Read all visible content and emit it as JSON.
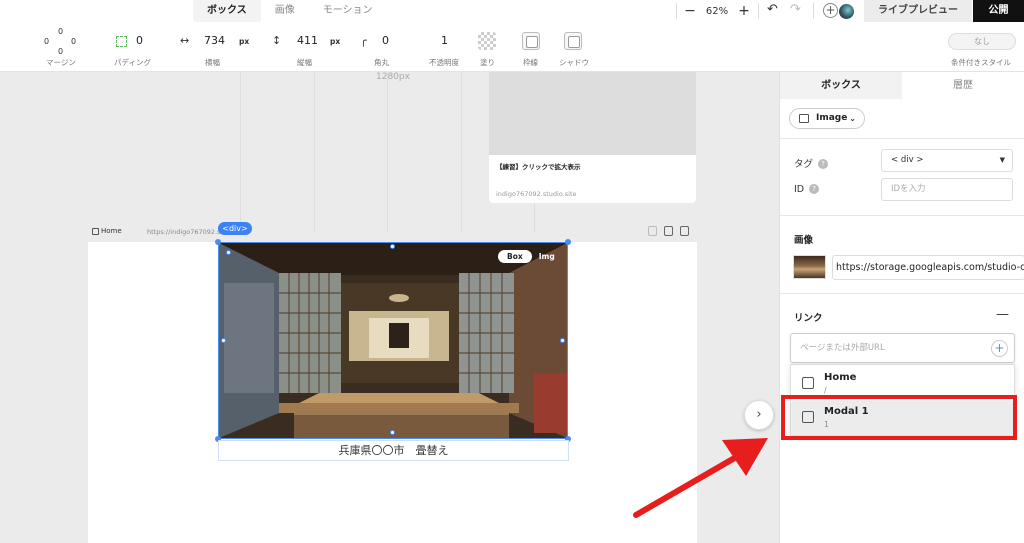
{
  "top_tabs": [
    "ボックス",
    "画像",
    "モーション"
  ],
  "zoom": {
    "minus": "−",
    "value": "62%",
    "plus": "+"
  },
  "header_buttons": {
    "live_preview": "ライブプレビュー",
    "publish": "公開"
  },
  "properties": {
    "margin": {
      "top": "0",
      "left": "0",
      "right": "0",
      "bottom": "0",
      "label": "マージン"
    },
    "padding": {
      "value": "0",
      "label": "パディング"
    },
    "width": {
      "value": "734",
      "unit": "px",
      "label": "横幅"
    },
    "height": {
      "value": "411",
      "unit": "px",
      "label": "縦幅"
    },
    "radius": {
      "value": "0",
      "label": "角丸"
    },
    "opacity": {
      "value": "1",
      "label": "不透明度"
    },
    "fill": {
      "label": "塗り"
    },
    "border": {
      "label": "枠線"
    },
    "shadow": {
      "label": "シャドウ"
    },
    "conditional": {
      "button": "なし",
      "label": "条件付きスタイル"
    }
  },
  "canvas": {
    "width_label": "1280px",
    "card_title": "【練習】クリックで拡大表示",
    "card_url": "indigo767092.studio.site",
    "frame_name": "Home",
    "frame_url": "https://indigo767092.stu",
    "element_badge": "<div>",
    "toggle_box": "Box",
    "toggle_img": "Img",
    "caption": "兵庫県〇〇市　畳替え"
  },
  "panel": {
    "tabs": [
      "ボックス",
      "層歴"
    ],
    "element_type": "Image",
    "tag_label": "タグ",
    "tag_value": "< div >",
    "id_label": "ID",
    "id_placeholder": "IDを入力",
    "image_section": "画像",
    "image_url": "https://storage.googleapis.com/studio-c",
    "link_section": "リンク",
    "link_placeholder": "ページまたは外部URL",
    "link_options": [
      {
        "name": "Home",
        "path": "/"
      },
      {
        "name": "Modal 1",
        "path": "1"
      }
    ]
  },
  "colors": {
    "accent": "#4a8cf0",
    "annotation": "#e81e1e",
    "publish_bg": "#111111"
  }
}
